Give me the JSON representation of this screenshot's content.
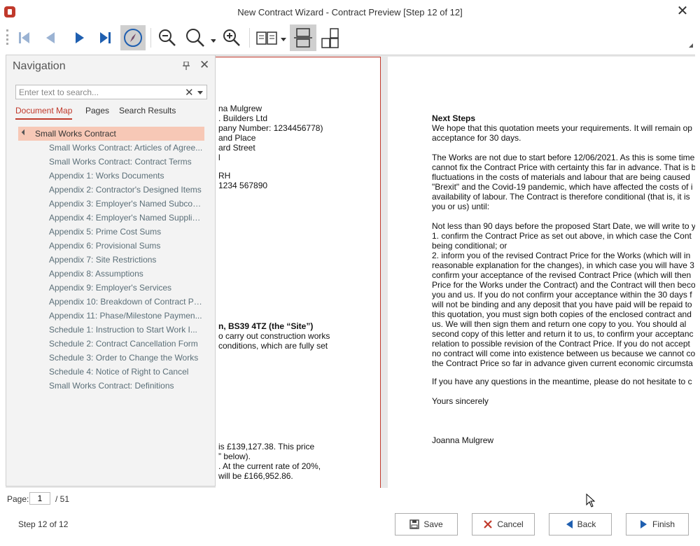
{
  "window": {
    "title": "New Contract Wizard - Contract Preview [Step 12 of 12]",
    "close_glyph": "✕"
  },
  "toolbar": {
    "buttons": [
      "first-page-icon",
      "previous-page-icon",
      "next-page-icon",
      "last-page-icon",
      "navigation-pane-icon",
      "zoom-out-icon",
      "zoom-icon",
      "zoom-in-icon",
      "page-view-icon",
      "single-page-icon",
      "multi-page-icon"
    ],
    "colors": {
      "accent": "#c0392b",
      "nav_blue": "#1f5fb0"
    }
  },
  "navigation": {
    "title": "Navigation",
    "pin_glyph": "📌",
    "close_glyph": "✕",
    "search_placeholder": "Enter text to search...",
    "clear_glyph": "✕",
    "tabs": [
      {
        "label": "Document Map",
        "active": true
      },
      {
        "label": "Pages",
        "active": false
      },
      {
        "label": "Search Results",
        "active": false
      }
    ],
    "tree": {
      "root": "Small Works Contract",
      "items": [
        "Small Works Contract: Articles of Agree...",
        "Small Works Contract: Contract Terms",
        "Appendix 1: Works Documents",
        "Appendix 2: Contractor's Designed Items",
        "Appendix 3: Employer's Named Subcon...",
        "Appendix 4: Employer's Named Suppliers",
        "Appendix 5: Prime Cost Sums",
        "Appendix 6: Provisional Sums",
        "Appendix 7: Site Restrictions",
        "Appendix 8: Assumptions",
        "Appendix 9: Employer's Services",
        "Appendix 10: Breakdown of Contract Pr...",
        "Appendix 11: Phase/Milestone Paymen...",
        "Schedule 1: Instruction to Start Work I...",
        "Schedule 2: Contract Cancellation Form",
        "Schedule 3: Order to Change the Works",
        "Schedule 4: Notice of Right to Cancel",
        "Small Works Contract: Definitions"
      ]
    }
  },
  "document": {
    "page1_lines": [
      {
        "text": "na Mulgrew",
        "bold": false
      },
      {
        "text": ". Builders Ltd",
        "bold": false
      },
      {
        "text": "pany Number: 1234456778)",
        "bold": false
      },
      {
        "text": "and Place",
        "bold": false
      },
      {
        "text": "ard Street",
        "bold": false
      },
      {
        "text": "l",
        "bold": false
      },
      {
        "text": "",
        "bold": false
      },
      {
        "text": "RH",
        "bold": false
      },
      {
        "text": "1234 567890",
        "bold": false
      },
      {
        "text": "n, BS39 4TZ (the “Site”)",
        "bold": true
      },
      {
        "text": "o carry out construction works",
        "bold": false
      },
      {
        "text": "conditions, which are fully set",
        "bold": false
      },
      {
        "text": "is £139,127.38.  This price",
        "bold": false
      },
      {
        "text": "” below).",
        "bold": false
      },
      {
        "text": ". At the current rate of 20%,",
        "bold": false
      },
      {
        "text": "will be £166,952.86.",
        "bold": false
      }
    ],
    "page2_lines": [
      {
        "text": "Next Steps",
        "bold": true
      },
      {
        "text": "We hope that this quotation meets your requirements. It will remain op",
        "bold": false
      },
      {
        "text": "acceptance for 30 days.",
        "bold": false
      },
      {
        "text": "The Works are not due to start before 12/06/2021. As this is some time",
        "bold": false
      },
      {
        "text": "cannot fix the Contract Price with certainty this far in advance. That is b",
        "bold": false
      },
      {
        "text": "fluctuations in the costs of materials and labour that are being caused",
        "bold": false
      },
      {
        "text": "\"Brexit\" and the Covid-19 pandemic, which have affected the costs of i",
        "bold": false
      },
      {
        "text": "availability of labour.  The Contract is therefore conditional (that is, it is",
        "bold": false
      },
      {
        "text": "you or us) until:",
        "bold": false
      },
      {
        "text": "Not less than 90 days before the proposed Start Date, we will write to y",
        "bold": false
      },
      {
        "text": "1.  confirm the Contract Price as set out above, in which case the Cont",
        "bold": false
      },
      {
        "text": "being conditional; or",
        "bold": false
      },
      {
        "text": "2.  inform you of the revised Contract Price for the Works (which will in",
        "bold": false
      },
      {
        "text": "reasonable explanation for the changes), in which case you will have 3",
        "bold": false
      },
      {
        "text": "confirm your acceptance of the revised Contract Price (which will then",
        "bold": false
      },
      {
        "text": "Price for the Works under the Contract) and the Contract will then beco",
        "bold": false
      },
      {
        "text": "you and us.  If you do not confirm your acceptance within the 30 days f",
        "bold": false
      },
      {
        "text": "will not be binding and any deposit that you have paid will be repaid to",
        "bold": false
      },
      {
        "text": "this quotation, you must sign both copies of the enclosed contract and",
        "bold": false
      },
      {
        "text": "us.  We will then sign them and return one copy to you.  You should al",
        "bold": false
      },
      {
        "text": "second copy of this letter and return it to us, to confirm your acceptanc",
        "bold": false
      },
      {
        "text": "relation to possible revision of the Contract Price.  If you do not accept",
        "bold": false
      },
      {
        "text": "no contract will come into existence between us because we cannot co",
        "bold": false
      },
      {
        "text": "the Contract Price so far in advance given current economic circumsta",
        "bold": false
      },
      {
        "text": "If you have any questions in the meantime, please do not hesitate to c",
        "bold": false
      },
      {
        "text": "Yours sincerely",
        "bold": false
      },
      {
        "text": "Joanna Mulgrew",
        "bold": false
      }
    ]
  },
  "status": {
    "page_label": "Page:",
    "page_value": "1",
    "page_total": "/ 51"
  },
  "footer": {
    "step_text": "Step 12 of 12",
    "save_label": "Save",
    "cancel_label": "Cancel",
    "back_label": "Back",
    "finish_label": "Finish"
  }
}
